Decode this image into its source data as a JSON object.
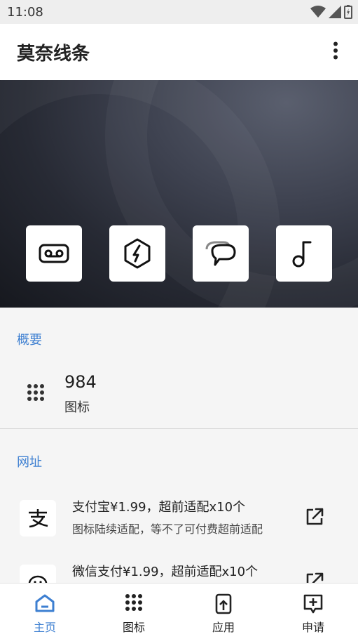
{
  "status_bar": {
    "time": "11:08"
  },
  "app_bar": {
    "title": "莫奈线条"
  },
  "hero": {
    "tiles": [
      {
        "icon": "voicemail-icon"
      },
      {
        "icon": "hexagon-bolt-icon"
      },
      {
        "icon": "chat-bubbles-icon"
      },
      {
        "icon": "music-note-icon"
      }
    ]
  },
  "summary": {
    "header": "概要",
    "count": "984",
    "label": "图标"
  },
  "links": {
    "header": "网址",
    "items": [
      {
        "title": "支付宝¥1.99，超前适配x10个",
        "subtitle": "图标陆续适配，等不了可付费超前适配",
        "logo": "alipay-logo"
      },
      {
        "title": "微信支付¥1.99，超前适配x10个",
        "subtitle": "",
        "logo": "wechat-logo"
      }
    ]
  },
  "bottom_nav": {
    "items": [
      {
        "label": "主页",
        "icon": "home-icon",
        "active": true
      },
      {
        "label": "图标",
        "icon": "grid-icon",
        "active": false
      },
      {
        "label": "应用",
        "icon": "app-upload-icon",
        "active": false
      },
      {
        "label": "申请",
        "icon": "request-add-icon",
        "active": false
      }
    ]
  },
  "colors": {
    "accent": "#3d7fd1",
    "hero_dark": "#16181e",
    "background": "#f5f5f5"
  }
}
